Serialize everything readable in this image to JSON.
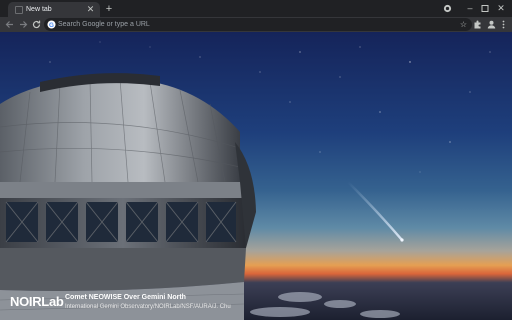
{
  "browser": {
    "tab": {
      "title": "New tab"
    },
    "omnibox": {
      "placeholder": "Search Google or type a URL"
    },
    "accent": "#35363a",
    "frame": "#202124"
  },
  "icons": {
    "tab_favicon": "new-tab-favicon",
    "tab_close": "close-icon",
    "new_tab": "plus-icon",
    "back": "arrow-left-icon",
    "forward": "arrow-right-icon",
    "reload": "reload-icon",
    "google": "google-g-icon",
    "star": "star-icon",
    "extensions": "puzzle-icon",
    "profile": "person-icon",
    "menu": "three-dot-menu-icon",
    "minimize": "minimize-icon",
    "maximize": "maximize-icon",
    "close_window": "close-icon"
  },
  "background": {
    "logo": "NOIRLab",
    "title": "Comet NEOWISE Over Gemini North",
    "credit": "International Gemini Observatory/NOIRLab/NSF/AURA/J. Chu"
  }
}
